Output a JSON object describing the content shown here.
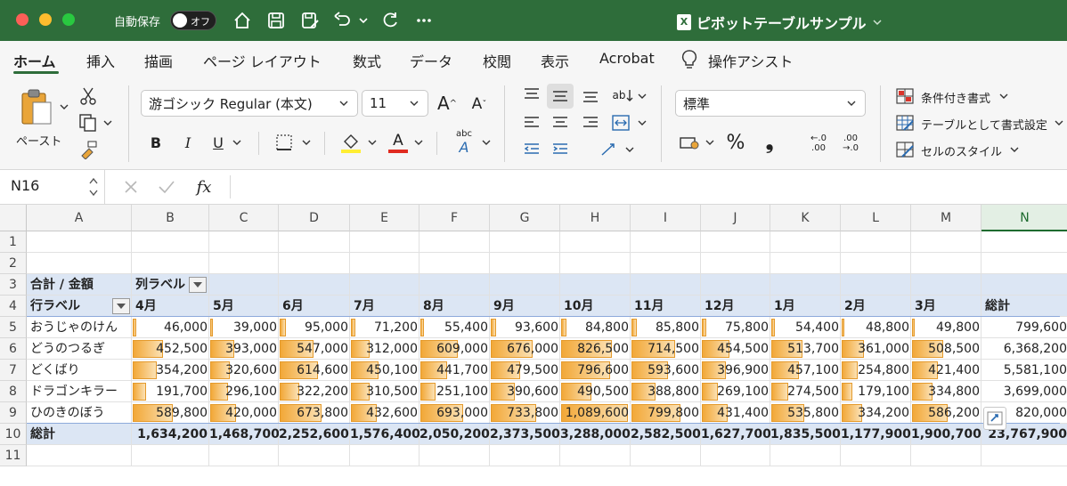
{
  "titlebar": {
    "autosave_label": "自動保存",
    "autosave_state": "オフ",
    "doc_title": "ピボットテーブルサンプル",
    "icons": [
      "home-icon",
      "save-icon",
      "save-as-icon",
      "undo-icon",
      "redo-icon",
      "more-icon"
    ]
  },
  "tabs": [
    {
      "label": "ホーム",
      "active": true
    },
    {
      "label": "挿入"
    },
    {
      "label": "描画"
    },
    {
      "label": "ページ レイアウト"
    },
    {
      "label": "数式"
    },
    {
      "label": "データ"
    },
    {
      "label": "校閲"
    },
    {
      "label": "表示"
    },
    {
      "label": "Acrobat"
    },
    {
      "label": "操作アシスト"
    }
  ],
  "ribbon": {
    "paste_label": "ペースト",
    "font_name": "游ゴシック Regular (本文)",
    "font_size": "11",
    "bold": "B",
    "italic": "I",
    "underline": "U",
    "number_format": "標準",
    "percent": "%",
    "comma": "❟",
    "cond_format": "条件付き書式",
    "format_as_table": "テーブルとして書式設定",
    "cell_styles": "セルのスタイル",
    "font_color": "#e02b20",
    "fill_color": "#ffee33"
  },
  "formula_bar": {
    "name_box": "N16",
    "fx": "fx",
    "formula": ""
  },
  "sheet": {
    "columns": [
      "A",
      "B",
      "C",
      "D",
      "E",
      "F",
      "G",
      "H",
      "I",
      "J",
      "K",
      "L",
      "M",
      "N"
    ],
    "selected_column": "N",
    "rows": [
      "1",
      "2",
      "3",
      "4",
      "5",
      "6",
      "7",
      "8",
      "9",
      "10",
      "11"
    ],
    "pivot": {
      "sum_label": "合計 / 金額",
      "col_label": "列ラベル",
      "row_label": "行ラベル",
      "months": [
        "4月",
        "5月",
        "6月",
        "7月",
        "8月",
        "9月",
        "10月",
        "11月",
        "12月",
        "1月",
        "2月",
        "3月"
      ],
      "total_label": "総計",
      "items": [
        {
          "name": "おうじゃのけん",
          "values": [
            "46,000",
            "39,000",
            "95,000",
            "71,200",
            "55,400",
            "93,600",
            "84,800",
            "85,800",
            "75,800",
            "54,400",
            "48,800",
            "49,800"
          ],
          "nums": [
            46000,
            39000,
            95000,
            71200,
            55400,
            93600,
            84800,
            85800,
            75800,
            54400,
            48800,
            49800
          ],
          "total": "799,600"
        },
        {
          "name": "どうのつるぎ",
          "values": [
            "452,500",
            "393,000",
            "547,000",
            "312,000",
            "609,000",
            "676,000",
            "826,500",
            "714,500",
            "454,500",
            "513,700",
            "361,000",
            "508,500"
          ],
          "nums": [
            452500,
            393000,
            547000,
            312000,
            609000,
            676000,
            826500,
            714500,
            454500,
            513700,
            361000,
            508500
          ],
          "total": "6,368,200"
        },
        {
          "name": "どくばり",
          "values": [
            "354,200",
            "320,600",
            "614,600",
            "450,100",
            "441,700",
            "479,500",
            "796,600",
            "593,600",
            "396,900",
            "457,100",
            "254,800",
            "421,400"
          ],
          "nums": [
            354200,
            320600,
            614600,
            450100,
            441700,
            479500,
            796600,
            593600,
            396900,
            457100,
            254800,
            421400
          ],
          "total": "5,581,100"
        },
        {
          "name": "ドラゴンキラー",
          "values": [
            "191,700",
            "296,100",
            "322,200",
            "310,500",
            "251,100",
            "390,600",
            "490,500",
            "388,800",
            "269,100",
            "274,500",
            "179,100",
            "334,800"
          ],
          "nums": [
            191700,
            296100,
            322200,
            310500,
            251100,
            390600,
            490500,
            388800,
            269100,
            274500,
            179100,
            334800
          ],
          "total": "3,699,000"
        },
        {
          "name": "ひのきのぼう",
          "values": [
            "589,800",
            "420,000",
            "673,800",
            "432,600",
            "693,000",
            "733,800",
            "1,089,600",
            "799,800",
            "431,400",
            "535,800",
            "334,200",
            "586,200"
          ],
          "nums": [
            589800,
            420000,
            673800,
            432600,
            693000,
            733800,
            1089600,
            799800,
            431400,
            535800,
            334200,
            586200
          ],
          "total": "820,000"
        }
      ],
      "grand_totals": [
        "1,634,200",
        "1,468,700",
        "2,252,600",
        "1,576,400",
        "2,050,200",
        "2,373,500",
        "3,288,000",
        "2,582,500",
        "1,627,700",
        "1,835,500",
        "1,177,900",
        "1,900,700"
      ],
      "grand_total": "23,767,900",
      "databar_max": 1089600
    }
  }
}
